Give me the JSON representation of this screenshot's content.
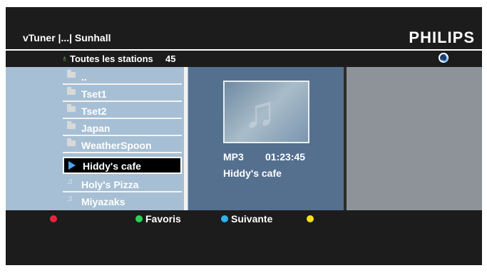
{
  "header": {
    "title": "vTuner |...| Sunhall",
    "brand": "PHILIPS"
  },
  "subheader": {
    "icon": "globe-icon",
    "label": "Toutes les stations",
    "count": "45",
    "status_icon": "loading-icon"
  },
  "list": {
    "items": [
      {
        "label": "..",
        "icon": "folder-icon"
      },
      {
        "label": "Tset1",
        "icon": "folder-icon"
      },
      {
        "label": "Tset2",
        "icon": "folder-icon"
      },
      {
        "label": "Japan",
        "icon": "folder-icon"
      },
      {
        "label": "WeatherSpoon",
        "icon": "folder-icon"
      },
      {
        "label": "Hiddy's cafe",
        "icon": "play-icon",
        "selected": true
      },
      {
        "label": "Holy's Pizza",
        "icon": "music-note-icon"
      },
      {
        "label": "Miyazaks",
        "icon": "music-note-icon"
      }
    ]
  },
  "details": {
    "format": "MP3",
    "time": "01:23:45",
    "name": "Hiddy's cafe",
    "art_icon": "music-note-icon"
  },
  "footer": {
    "red": {
      "label": "",
      "color": "#e8243a"
    },
    "green": {
      "label": "Favoris",
      "color": "#2fcf5a"
    },
    "blue": {
      "label": "Suivante",
      "color": "#2fb0f0"
    },
    "yellow": {
      "label": "",
      "color": "#f2e21a"
    }
  }
}
